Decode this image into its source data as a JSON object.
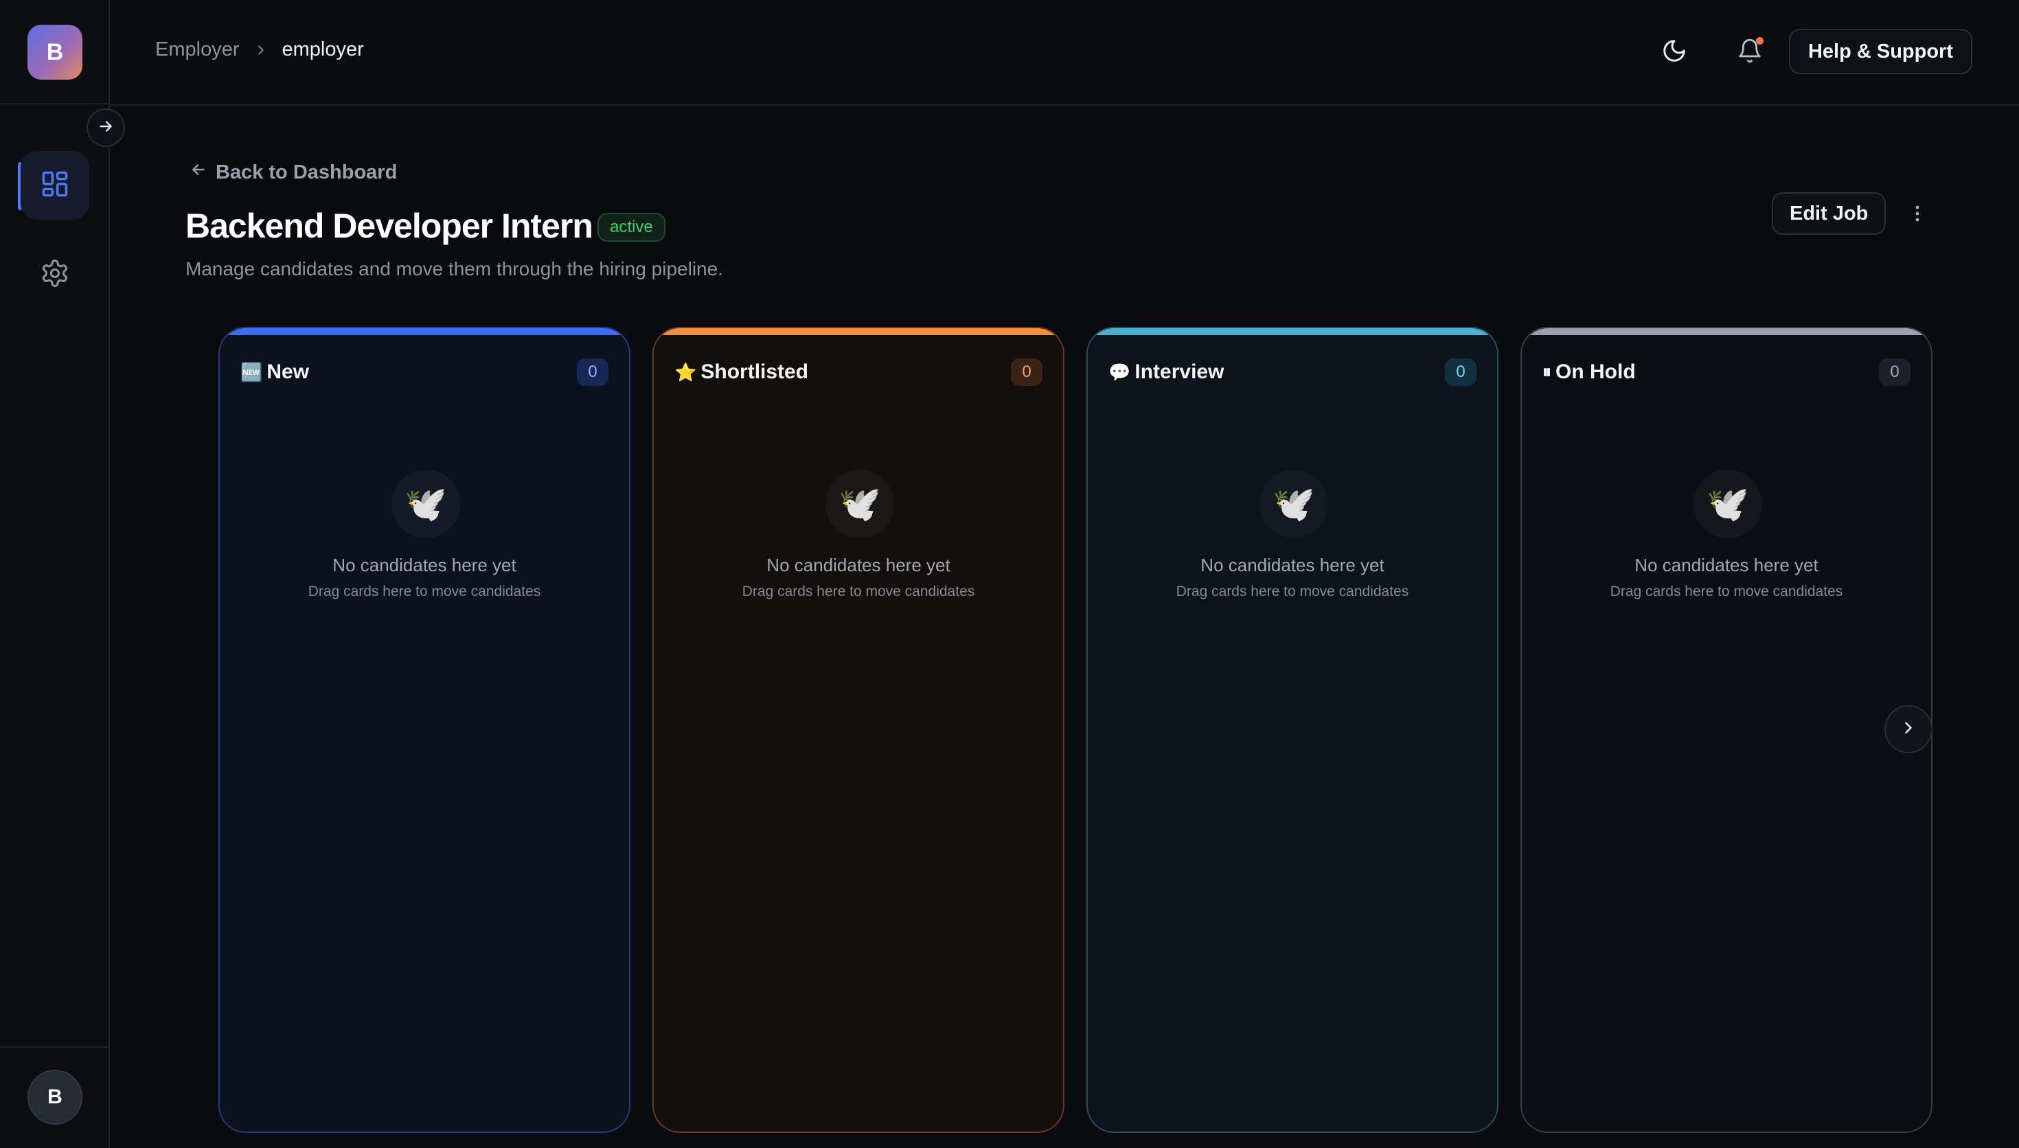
{
  "sidebar": {
    "logo_letter": "B",
    "nav": [
      {
        "name": "dashboard",
        "icon": "dashboard-grid-icon",
        "active": true
      },
      {
        "name": "settings",
        "icon": "gear-icon",
        "active": false
      }
    ],
    "user_initial": "B"
  },
  "topbar": {
    "breadcrumb": {
      "parent": "Employer",
      "current": "employer"
    },
    "help_label": "Help & Support"
  },
  "page": {
    "back_label": "Back to Dashboard",
    "title": "Backend Developer Intern",
    "status": "active",
    "subtitle": "Manage candidates and move them through the hiring pipeline.",
    "edit_label": "Edit Job"
  },
  "columns": [
    {
      "emoji": "🆕",
      "title": "New",
      "count": "0",
      "empty_title": "No candidates here yet",
      "empty_sub": "Drag cards here to move candidates",
      "accent": "#3b6ef5"
    },
    {
      "emoji": "⭐",
      "title": "Shortlisted",
      "count": "0",
      "empty_title": "No candidates here yet",
      "empty_sub": "Drag cards here to move candidates",
      "accent": "#f0903c"
    },
    {
      "emoji": "💬",
      "title": "Interview",
      "count": "0",
      "empty_title": "No candidates here yet",
      "empty_sub": "Drag cards here to move candidates",
      "accent": "#4bb0d0"
    },
    {
      "emoji": "⏸",
      "title": "On Hold",
      "count": "0",
      "empty_title": "No candidates here yet",
      "empty_sub": "Drag cards here to move candidates",
      "accent": "#9aa0ab"
    }
  ],
  "empty_icon": "🕊️",
  "colors": {
    "background": "#0a0b0e",
    "primary": "#4f7cf5",
    "success": "#3fcf6e",
    "notification": "#f0763c"
  }
}
